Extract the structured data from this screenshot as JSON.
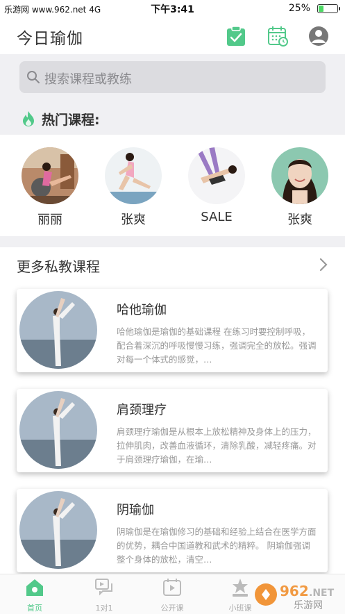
{
  "statusbar": {
    "carrier": "乐游网 www.962.net 4G",
    "time": "下午3:41",
    "battery": "25%",
    "battery_level": 0.25
  },
  "header": {
    "title": "今日瑜伽",
    "icons": [
      "checkin-clipboard-icon",
      "calendar-clock-icon",
      "user-profile-icon"
    ],
    "accent": "#52c98a"
  },
  "search": {
    "placeholder": "搜索课程或教练"
  },
  "hot": {
    "label": "热门课程:"
  },
  "teachers": [
    {
      "name": "丽丽"
    },
    {
      "name": "张爽"
    },
    {
      "name": "SALE"
    },
    {
      "name": "张爽"
    }
  ],
  "more": {
    "label": "更多私教课程"
  },
  "courses": [
    {
      "title": "哈他瑜伽",
      "desc": "哈他瑜伽是瑜伽的基础课程  在练习时要控制呼吸，配合着深沉的呼吸慢慢习练，强调完全的放松。强调对每一个体式的感觉，…"
    },
    {
      "title": "肩颈理疗",
      "desc": "肩颈理疗瑜伽是从根本上放松精神及身体上的压力，拉伸肌肉，改善血液循环，清除乳酸，减轻疼痛。对于肩颈理疗瑜伽，在瑜…"
    },
    {
      "title": "阴瑜伽",
      "desc": "阴瑜伽是在瑜伽修习的基础和经验上结合在医学方面的优势，耦合中国道教和武术的精粹。 阴瑜伽强调整个身体的放松，清空…"
    }
  ],
  "tabs": [
    {
      "label": "首页",
      "icon": "home-icon",
      "active": true
    },
    {
      "label": "1对1",
      "icon": "chat-icon",
      "active": false
    },
    {
      "label": "公开课",
      "icon": "video-icon",
      "active": false
    },
    {
      "label": "小班课",
      "icon": "star-icon",
      "active": false
    }
  ],
  "watermark": {
    "site": "962.NET",
    "name": "乐游网"
  }
}
